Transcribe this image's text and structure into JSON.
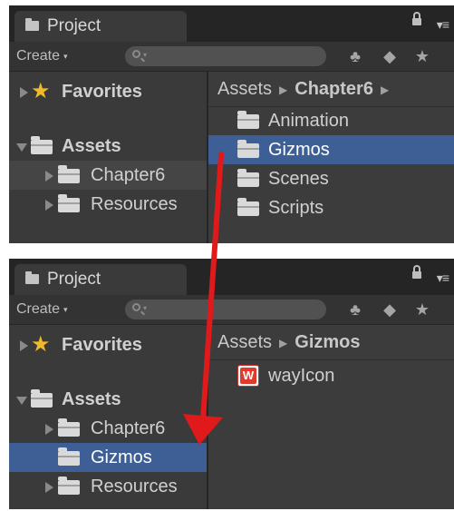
{
  "panel_top": {
    "tab_label": "Project",
    "create_label": "Create",
    "favorites_label": "Favorites",
    "assets_label": "Assets",
    "tree_items": [
      "Chapter6",
      "Resources"
    ],
    "breadcrumb": [
      "Assets",
      "Chapter6"
    ],
    "folders": [
      "Animation",
      "Gizmos",
      "Scenes",
      "Scripts"
    ],
    "selected_folder": "Gizmos"
  },
  "panel_bottom": {
    "tab_label": "Project",
    "create_label": "Create",
    "favorites_label": "Favorites",
    "assets_label": "Assets",
    "tree_items": [
      "Chapter6",
      "Gizmos",
      "Resources"
    ],
    "selected_tree_item": "Gizmos",
    "breadcrumb": [
      "Assets",
      "Gizmos"
    ],
    "files": [
      "wayIcon"
    ]
  },
  "colors": {
    "selection": "#3e5f96",
    "panel_bg": "#3c3c3c",
    "arrow": "#e0191a",
    "star": "#f0b92a"
  },
  "icons": [
    "folder-icon",
    "star-icon",
    "search-icon",
    "lock-icon",
    "menu-icon",
    "filter-by-type-icon",
    "filter-by-label-icon",
    "favorite-icon",
    "gizmo-icon"
  ]
}
